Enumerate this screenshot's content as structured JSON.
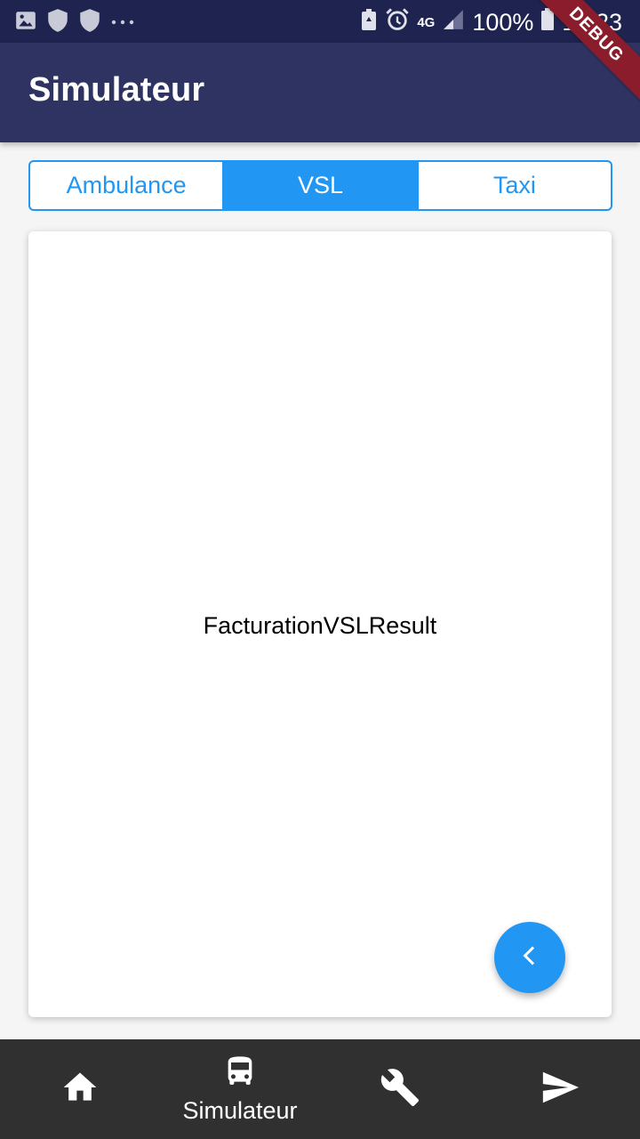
{
  "status_bar": {
    "network": "4G",
    "battery": "100%",
    "time": "15:23",
    "left_icons": [
      "image-icon",
      "shield-icon",
      "shield-icon",
      "more-dots-icon"
    ],
    "right_icons": [
      "battery-saver-icon",
      "alarm-icon",
      "signal-icon",
      "battery-icon"
    ]
  },
  "app_bar": {
    "title": "Simulateur",
    "debug_banner": "DEBUG"
  },
  "tabs": {
    "items": [
      {
        "label": "Ambulance",
        "active": false
      },
      {
        "label": "VSL",
        "active": true
      },
      {
        "label": "Taxi",
        "active": false
      }
    ]
  },
  "card": {
    "content": "FacturationVSLResult"
  },
  "fab": {
    "icon": "chevron-left-icon"
  },
  "bottom_nav": {
    "items": [
      {
        "icon": "home-icon",
        "label": ""
      },
      {
        "icon": "bus-icon",
        "label": "Simulateur",
        "active": true
      },
      {
        "icon": "wrench-icon",
        "label": ""
      },
      {
        "icon": "send-icon",
        "label": ""
      }
    ]
  },
  "colors": {
    "status_bar": "#1f2350",
    "app_bar": "#2e3362",
    "accent": "#2196f3",
    "bottom_nav": "#303030",
    "debug_banner": "#8b1c2b"
  }
}
